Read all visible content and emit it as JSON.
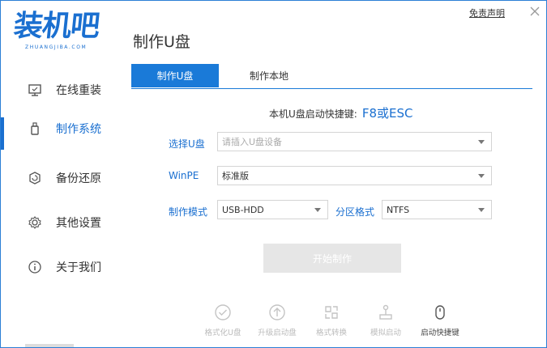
{
  "app": {
    "logo_text": "装机吧",
    "logo_sub": "ZHUANGJIBA.COM",
    "disclaimer": "免责声明",
    "close_glyph": "×",
    "page_title": "制作U盘"
  },
  "sidebar": {
    "items": [
      {
        "label": "在线重装",
        "icon": "monitor-icon"
      },
      {
        "label": "制作系统",
        "icon": "usb-icon",
        "active": true
      },
      {
        "label": "备份还原",
        "icon": "backup-icon"
      },
      {
        "label": "其他设置",
        "icon": "gear-icon"
      },
      {
        "label": "关于我们",
        "icon": "info-icon"
      }
    ]
  },
  "tabs": [
    {
      "label": "制作U盘",
      "active": true
    },
    {
      "label": "制作本地",
      "active": false
    }
  ],
  "hotkey": {
    "label": "本机U盘启动快捷键:",
    "key": "F8或ESC"
  },
  "form": {
    "usb_label": "选择U盘",
    "usb_placeholder": "请插入U盘设备",
    "winpe_label": "WinPE",
    "winpe_value": "标准版",
    "mode_label": "制作模式",
    "mode_value": "USB-HDD",
    "partition_label": "分区格式",
    "partition_value": "NTFS"
  },
  "start_button": "开始制作",
  "tools": [
    {
      "label": "格式化U盘",
      "icon": "check-circle-icon"
    },
    {
      "label": "升级启动盘",
      "icon": "upload-circle-icon"
    },
    {
      "label": "格式转换",
      "icon": "convert-icon"
    },
    {
      "label": "模拟启动",
      "icon": "joystick-icon"
    },
    {
      "label": "启动快捷键",
      "icon": "mouse-icon"
    }
  ],
  "colors": {
    "accent": "#1a6fd0",
    "tab_active": "#1a7ad8",
    "disabled_button": "#e6e6e6"
  }
}
